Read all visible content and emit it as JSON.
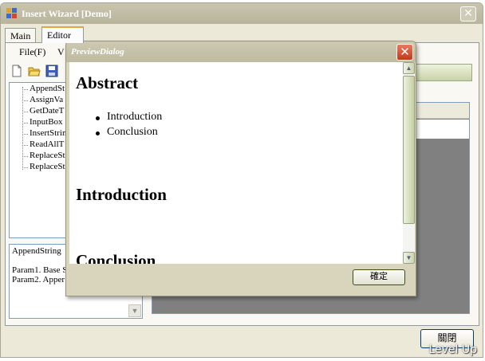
{
  "window": {
    "title": "Insert Wizard [Demo]",
    "close_glyph": "✕"
  },
  "tabs": [
    {
      "label": "Main"
    },
    {
      "label": "Editor"
    }
  ],
  "menu": [
    {
      "label": "File(F)"
    },
    {
      "label": "V"
    }
  ],
  "toolbar": {
    "icons": [
      "new-file-icon",
      "open-folder-icon",
      "save-icon"
    ]
  },
  "tree": {
    "items": [
      {
        "label": "AppendSt"
      },
      {
        "label": "AssignVa"
      },
      {
        "label": "GetDateT"
      },
      {
        "label": "InputBox"
      },
      {
        "label": "InsertStrin"
      },
      {
        "label": "ReadAllT"
      },
      {
        "label": "ReplaceSt"
      },
      {
        "label": "ReplaceSt"
      }
    ]
  },
  "description": {
    "lines": [
      "AppendString",
      "",
      "Param1. Base S",
      "Param2. Apper"
    ]
  },
  "grid": {
    "header_fragment": "a"
  },
  "close_button": {
    "label": "關閉"
  },
  "watermark": "Level Up",
  "dialog": {
    "title": "PreviewDialog",
    "close_glyph": "✕",
    "preview": {
      "heading_abstract": "Abstract",
      "bullets": [
        "Introduction",
        "Conclusion"
      ],
      "heading_introduction": "Introduction",
      "heading_conclusion": "Conclusion"
    },
    "ok_label": "確定"
  },
  "colors": {
    "title_bar": "#c4c0a8",
    "dialog_close": "#c2391c",
    "active_tab_accent": "#e8a33e",
    "grid_background": "#808080"
  }
}
